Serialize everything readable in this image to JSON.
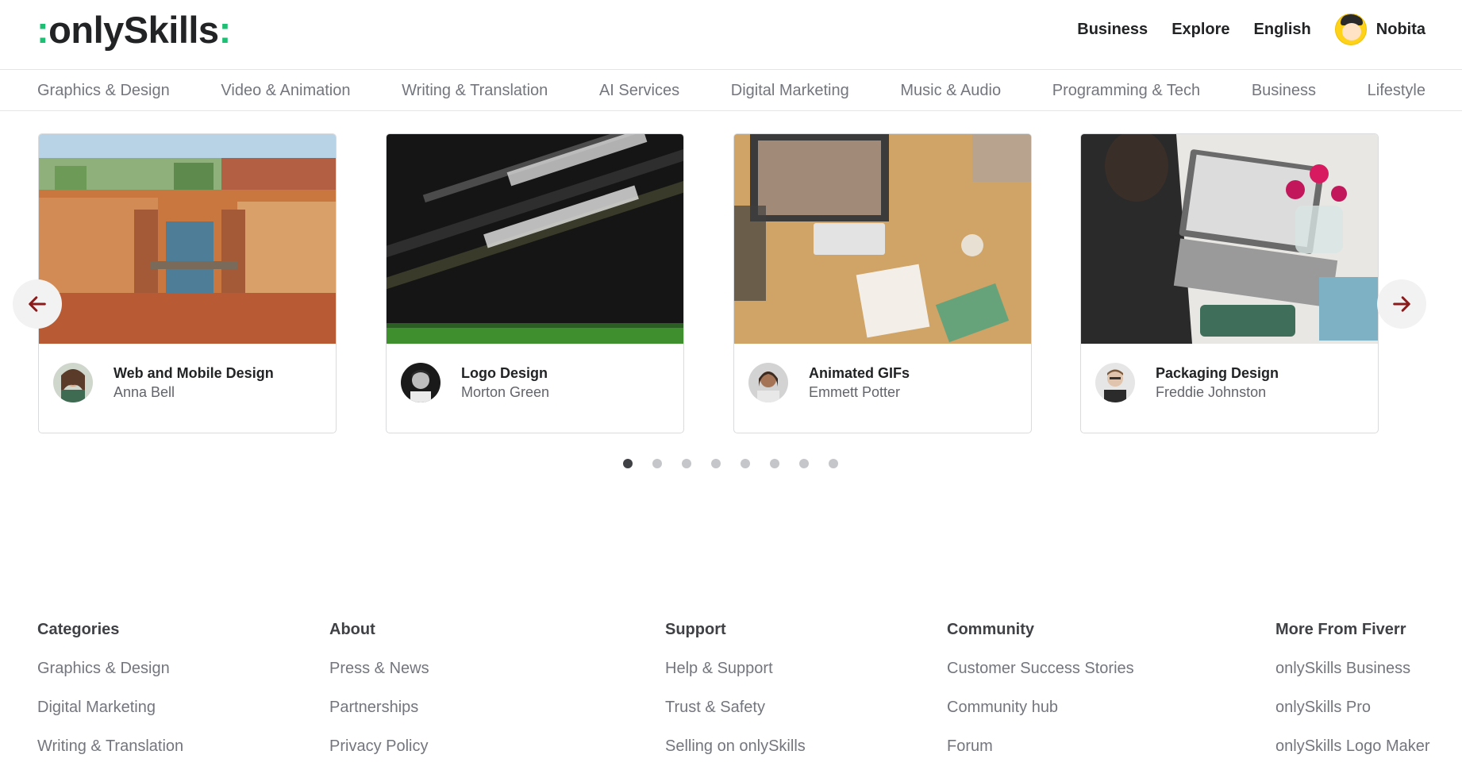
{
  "header": {
    "logo_text": "onlySkills",
    "logo_dot_color": "#1dbf73",
    "nav": [
      {
        "label": "Business"
      },
      {
        "label": "Explore"
      },
      {
        "label": "English"
      }
    ],
    "user_name": "Nobita"
  },
  "categories": [
    "Graphics & Design",
    "Video & Animation",
    "Writing & Translation",
    "AI Services",
    "Digital Marketing",
    "Music & Audio",
    "Programming & Tech",
    "Business",
    "Lifestyle"
  ],
  "carousel": {
    "prev_icon": "arrow-left-icon",
    "next_icon": "arrow-right-icon",
    "arrow_color": "#8b1a1a",
    "cards": [
      {
        "title": "Web and Mobile Design",
        "seller": "Anna Bell",
        "image": "venice-canal-photo"
      },
      {
        "title": "Logo Design",
        "seller": "Morton Green",
        "image": "code-screen-photo"
      },
      {
        "title": "Animated GIFs",
        "seller": "Emmett Potter",
        "image": "desk-workspace-photo"
      },
      {
        "title": "Packaging Design",
        "seller": "Freddie Johnston",
        "image": "laptop-flowers-photo"
      }
    ],
    "page_count": 8,
    "active_page": 1
  },
  "footer": {
    "columns": [
      {
        "heading": "Categories",
        "links": [
          "Graphics & Design",
          "Digital Marketing",
          "Writing & Translation"
        ]
      },
      {
        "heading": "About",
        "links": [
          "Press & News",
          "Partnerships",
          "Privacy Policy"
        ]
      },
      {
        "heading": "Support",
        "links": [
          "Help & Support",
          "Trust & Safety",
          "Selling on onlySkills"
        ]
      },
      {
        "heading": "Community",
        "links": [
          "Customer Success Stories",
          "Community hub",
          "Forum"
        ]
      },
      {
        "heading": "More From Fiverr",
        "links": [
          "onlySkills Business",
          "onlySkills Pro",
          "onlySkills Logo Maker"
        ]
      }
    ]
  }
}
